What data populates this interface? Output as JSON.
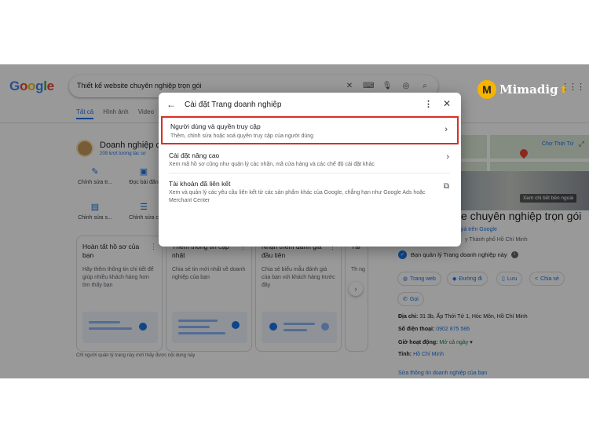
{
  "search": {
    "query": "Thiết kế website chuyên nghiệp trọn gói",
    "tabs": [
      "Tất cả",
      "Hình ảnh",
      "Video"
    ]
  },
  "brand_logo": {
    "letter": "M",
    "text": "Mimadig"
  },
  "business": {
    "name": "Doanh nghiệp củ",
    "sub": "209 lượt tương tác sơ",
    "actions": [
      {
        "icon": "pencil-icon",
        "label": "Chỉnh sửa tr..."
      },
      {
        "icon": "post-icon",
        "label": "Đọc bài đăn"
      },
      {
        "icon": "shopping-bag-icon",
        "label": "Chỉnh sửa s..."
      },
      {
        "icon": "list-icon",
        "label": "Chỉnh sửa c"
      }
    ],
    "cards": [
      {
        "title": "Hoàn tất hồ sơ của bạn",
        "body": "Hãy thêm thông tin chi tiết để giúp nhiều khách hàng hơn tìm thấy bạn"
      },
      {
        "title": "Thêm thông tin cập nhật",
        "body": "Chia sẻ tin mới nhất về doanh nghiệp của bạn"
      },
      {
        "title": "Nhận thêm đánh giá đầu tiên",
        "body": "Chia sẻ biểu mẫu đánh giá của bạn với khách hàng trước đây"
      },
      {
        "title": "Tải",
        "body": "Th ng"
      }
    ],
    "footnote": "Chỉ người quản lý trang này mới thấy được nội dung này"
  },
  "knowledge_panel": {
    "map_label": "Chợ Thới Tứ",
    "photo_caption": "Xem chi tiết bên ngoài",
    "title": "ite chuyên nghiệp trọn gói",
    "reviews": "giá trên Google",
    "category": "y Thành phố Hồ Chí Minh",
    "manage": "Bạn quản lý Trang doanh nghiệp này",
    "chips": [
      "Trang web",
      "Đường đi",
      "Lưu",
      "Chia sẻ",
      "Gọi"
    ],
    "address_label": "Địa chỉ:",
    "address": "31 3b, Ấp Thới Tứ 1, Hóc Môn, Hồ Chí Minh",
    "phone_label": "Số điện thoại:",
    "phone": "0902 875 586",
    "hours_label": "Giờ hoạt động:",
    "hours": "Mở cả ngày",
    "province_label": "Tỉnh:",
    "province": "Hồ Chí Minh",
    "edit_link": "Sửa thông tin doanh nghiệp của bạn"
  },
  "dialog": {
    "title": "Cài đặt Trang doanh nghiệp",
    "rows": [
      {
        "title": "Người dùng và quyền truy cập",
        "desc": "Thêm, chỉnh sửa hoặc xoá quyền truy cập của người dùng",
        "highlighted": true
      },
      {
        "title": "Cài đặt nâng cao",
        "desc": "Xem mã hồ sơ cũng như quản lý các nhãn, mã cửa hàng và các chế độ cài đặt khác"
      },
      {
        "title": "Tài khoản đã liên kết",
        "desc": "Xem và quản lý các yêu cầu liên kết từ các sản phẩm khác của Google, chẳng hạn như Google Ads hoặc Merchant Center"
      }
    ]
  }
}
